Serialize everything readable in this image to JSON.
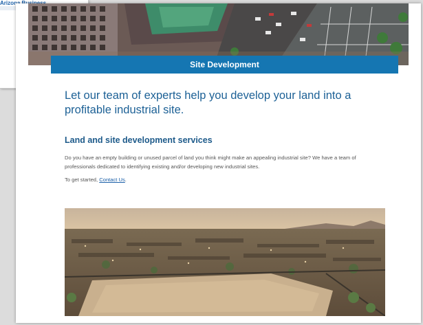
{
  "background_window": {
    "title": "Arizona Business"
  },
  "banner": {
    "title": "Site Development"
  },
  "main": {
    "headline": "Let our team of experts help you develop your land into a profitable industrial site.",
    "section_title": "Land and site development services",
    "body": "Do you have an empty building or unused parcel of land you think might make an appealing industrial site? We have a team of professionals dedicated to identifying existing and/or developing new industrial sites.",
    "cta_prefix": "To get started, ",
    "cta_link": "Contact Us",
    "cta_suffix": "."
  },
  "images": {
    "hero": "aerial city buildings and parking lot photo",
    "aerial": "aerial desert city landscape photo"
  },
  "colors": {
    "banner": "#1576b2",
    "headline": "#1d6196",
    "link": "#1a5fa8",
    "body_text": "#555555"
  }
}
